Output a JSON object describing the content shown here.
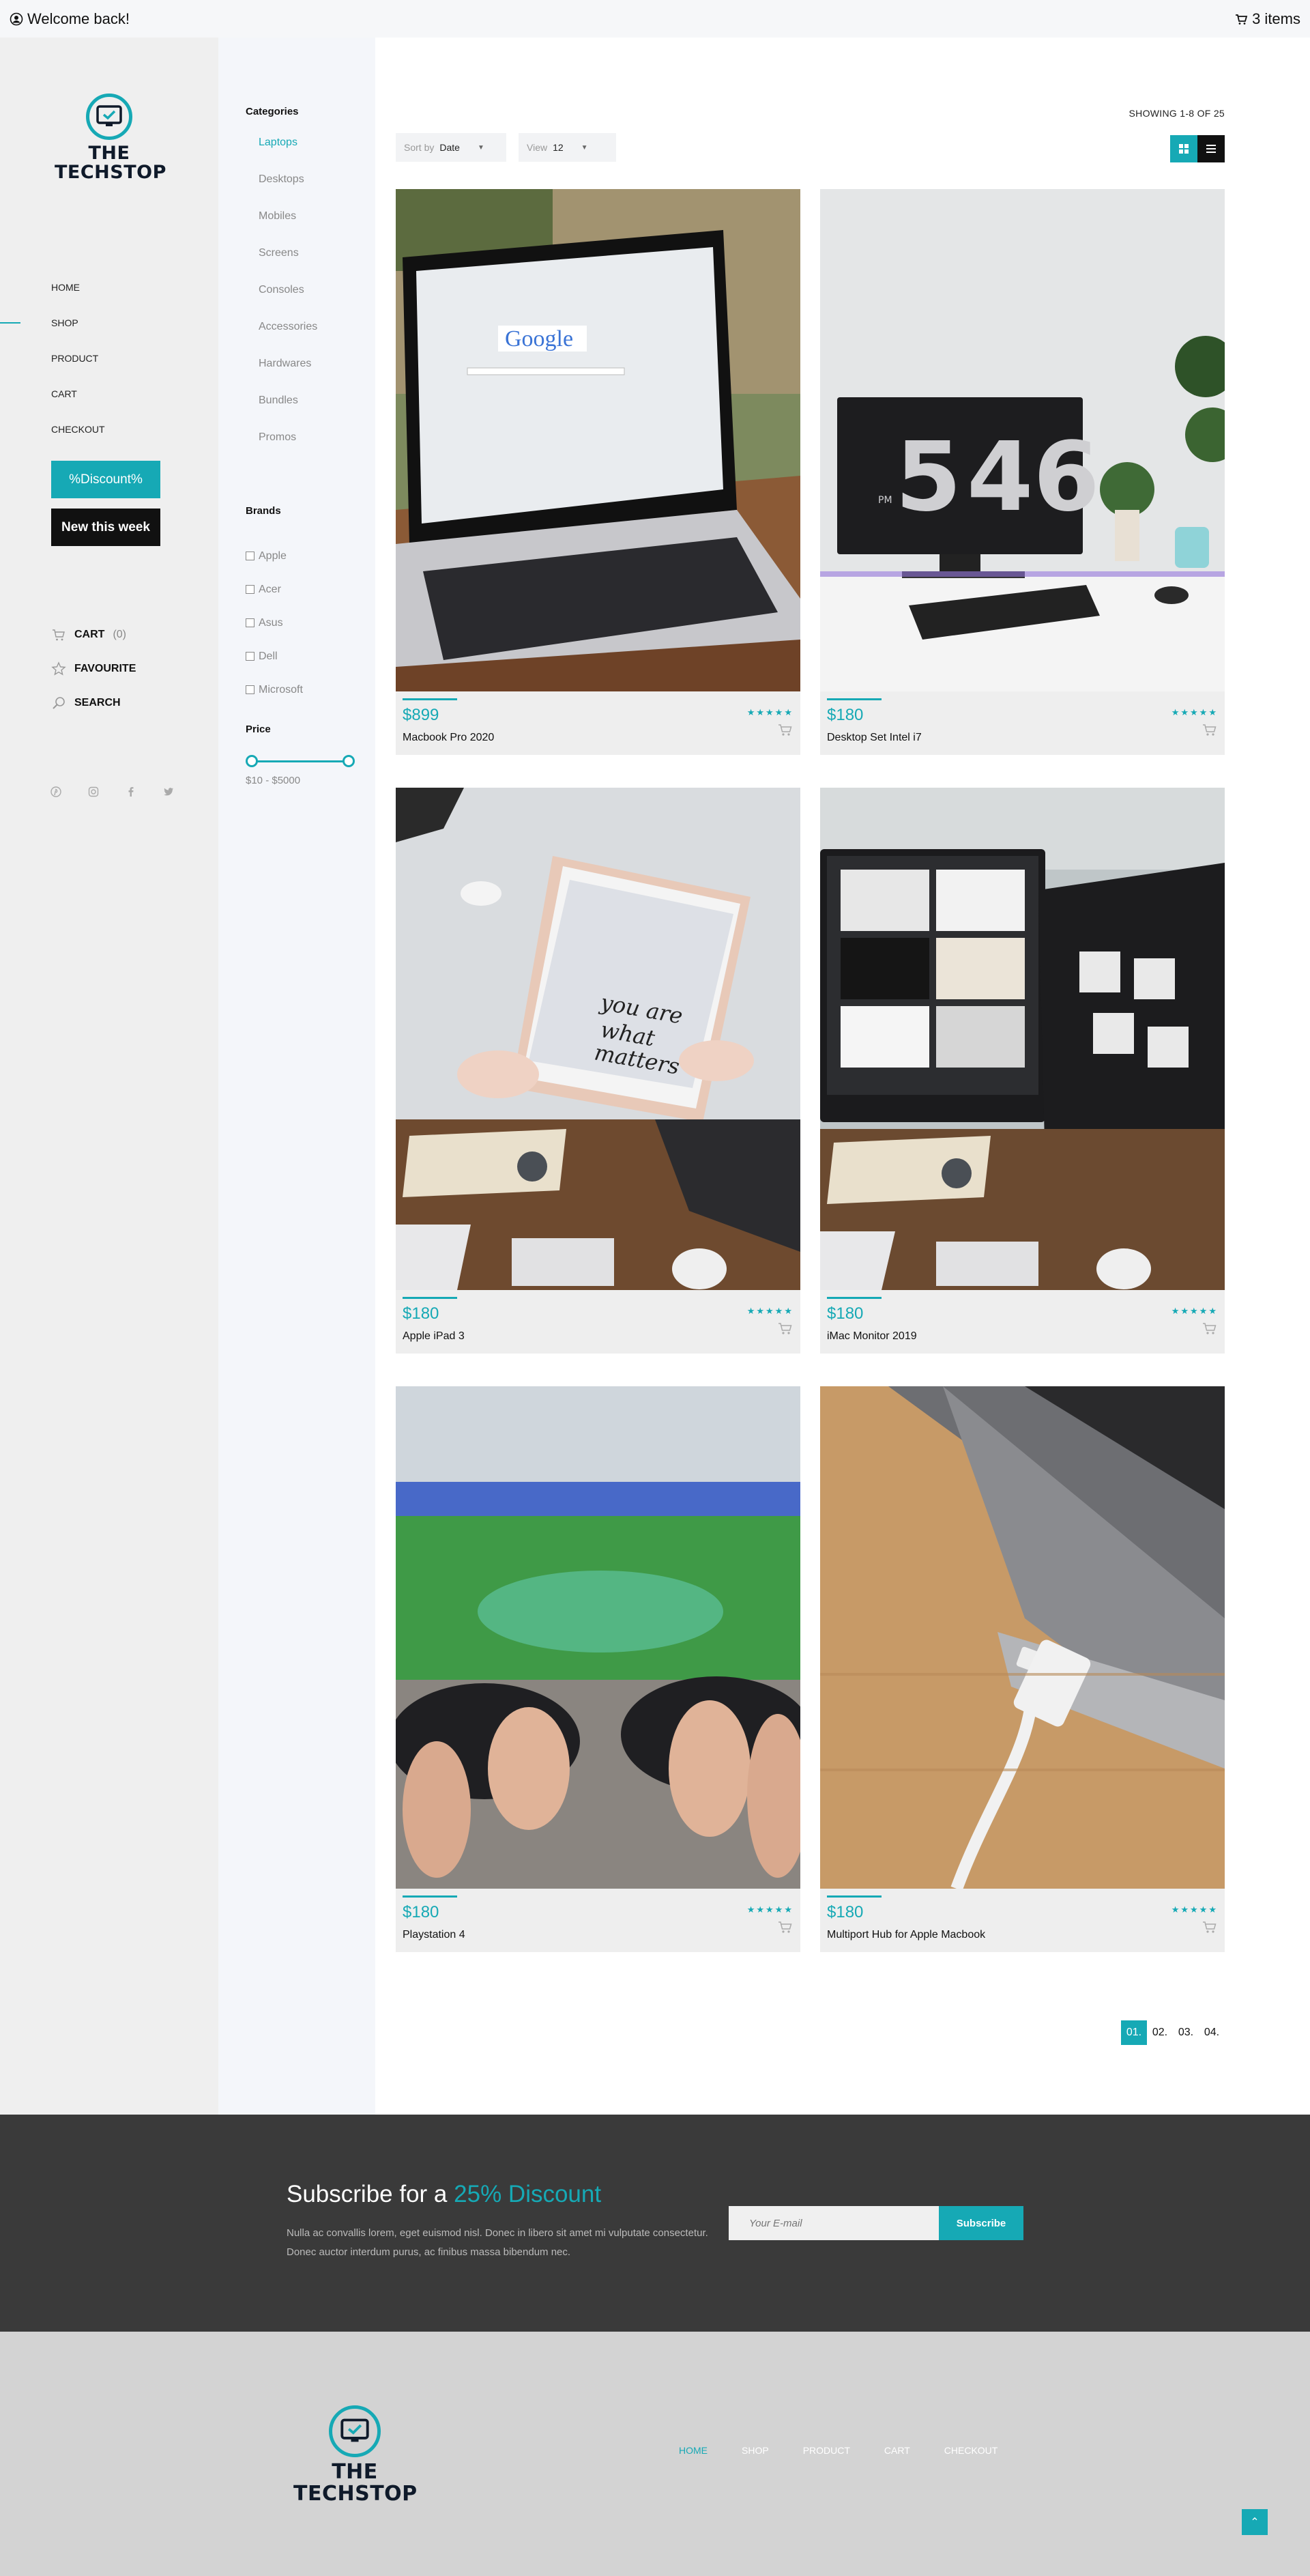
{
  "topbar": {
    "welcome": "Welcome back!",
    "cart_items": "3 items"
  },
  "brand": {
    "name_line1": "THE",
    "name_line2": "TECHSTOP",
    "accent_color": "#16a9b5"
  },
  "nav": {
    "items": [
      "HOME",
      "SHOP",
      "PRODUCT",
      "CART",
      "CHECKOUT"
    ],
    "active": "SHOP"
  },
  "promo": {
    "discount_label": "%Discount%",
    "new_week_label": "New this week"
  },
  "quicklinks": {
    "cart_label": "CART",
    "cart_count": "(0)",
    "favourite_label": "FAVOURITE",
    "search_label": "SEARCH"
  },
  "filters": {
    "categories_title": "Categories",
    "categories": [
      "Laptops",
      "Desktops",
      "Mobiles",
      "Screens",
      "Consoles",
      "Accessories",
      "Hardwares",
      "Bundles",
      "Promos"
    ],
    "active_category": "Laptops",
    "brands_title": "Brands",
    "brands": [
      "Apple",
      "Acer",
      "Asus",
      "Dell",
      "Microsoft"
    ],
    "price_title": "Price",
    "price_range": "$10 - $5000"
  },
  "toolbar": {
    "showing": "SHOWING 1-8 OF 25",
    "sort_label": "Sort by",
    "sort_value": "Date",
    "view_label": "View",
    "view_value": "12"
  },
  "products": [
    {
      "price": "$899",
      "name": "Macbook Pro 2020",
      "stars": "★★★★★"
    },
    {
      "price": "$180",
      "name": "Desktop Set Intel i7",
      "stars": "★★★★★"
    },
    {
      "price": "$180",
      "name": "Apple iPad 3",
      "stars": "★★★★★"
    },
    {
      "price": "$180",
      "name": "iMac Monitor 2019",
      "stars": "★★★★★"
    },
    {
      "price": "$180",
      "name": "Playstation 4",
      "stars": "★★★★★"
    },
    {
      "price": "$180",
      "name": "Multiport Hub for Apple Macbook",
      "stars": "★★★★★"
    }
  ],
  "pagination": {
    "pages": [
      "01.",
      "02.",
      "03.",
      "04."
    ],
    "active": "01."
  },
  "subscribe": {
    "heading_prefix": "Subscribe for a",
    "heading_accent": "25% Discount",
    "body": "Nulla ac convallis lorem, eget euismod nisl. Donec in libero sit amet mi vulputate consectetur. Donec auctor interdum purus, ac finibus massa bibendum nec.",
    "email_placeholder": "Your E-mail",
    "button": "Subscribe"
  },
  "footer": {
    "nav": [
      "HOME",
      "SHOP",
      "PRODUCT",
      "CART",
      "CHECKOUT"
    ],
    "active": "HOME"
  }
}
